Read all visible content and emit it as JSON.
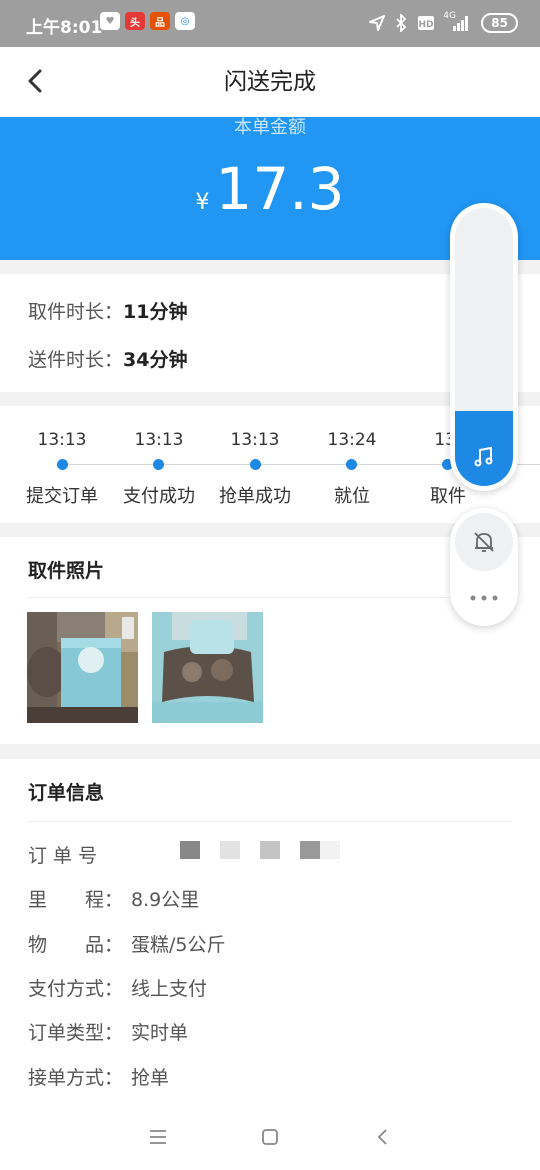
{
  "status_bar": {
    "time": "上午8:01",
    "app_icons": [
      "heart-app-icon",
      "news-app-icon",
      "shop-app-icon",
      "wallet-app-icon"
    ],
    "network": "4G",
    "battery": "85"
  },
  "app_bar": {
    "title": "闪送完成",
    "back_icon": "chevron-left-icon"
  },
  "amount": {
    "label": "本单金额",
    "currency": "¥",
    "value": "17.3"
  },
  "durations": {
    "pickup_label": "取件时长：",
    "pickup_value": "11分钟",
    "delivery_label": "送件时长：",
    "delivery_value": "34分钟"
  },
  "timeline": [
    {
      "time": "13:13",
      "label": "提交订单"
    },
    {
      "time": "13:13",
      "label": "支付成功"
    },
    {
      "time": "13:13",
      "label": "抢单成功"
    },
    {
      "time": "13:24",
      "label": "就位"
    },
    {
      "time": "13:",
      "label": "取件"
    }
  ],
  "photos": {
    "title": "取件照片"
  },
  "order_info": {
    "title": "订单信息",
    "order_no_label": "订 单 号",
    "distance_label": "里　　程：",
    "distance_value": "8.9公里",
    "item_label": "物　　品：",
    "item_value": "蛋糕/5公斤",
    "payment_label": "支付方式：",
    "payment_value": "线上支付",
    "type_label": "订单类型：",
    "type_value": "实时单",
    "accept_label": "接单方式：",
    "accept_value": "抢单"
  },
  "floating_controls": {
    "music_icon": "music-note-icon",
    "mute_icon": "bell-off-icon",
    "more_icon": "more-dots-icon"
  },
  "nav_bar": {
    "menu_icon": "menu-icon",
    "home_icon": "home-square-icon",
    "back_icon": "back-triangle-icon"
  },
  "colors": {
    "accent": "#2196f3",
    "status_bar": "#9e9e9e"
  }
}
